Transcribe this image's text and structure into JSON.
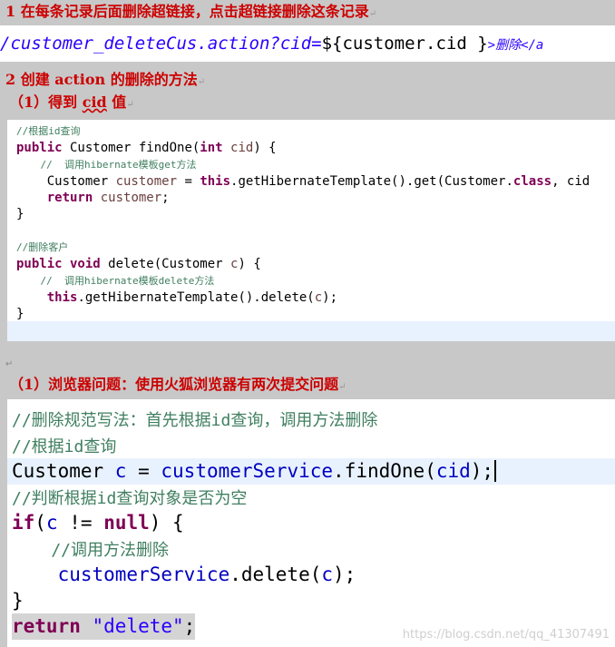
{
  "headings": {
    "h1": "1 在每条记录后面删除超链接，点击超链接删除这条记录",
    "h2": "2 创建 action 的删除的方法",
    "h2_sub_prefix": "（1）得到 ",
    "h2_sub_cid": "cid",
    "h2_sub_suffix": " 值",
    "h3": "（1）浏览器问题：使用火狐浏览器有两次提交问题",
    "return_mark": "↵"
  },
  "url_line": {
    "part1": "/customer_deleteCus.action?cid=",
    "part2": "${customer.cid }",
    "part3": ">删除</a"
  },
  "code1": {
    "c1": "//根据id查询",
    "l1_kw": "public",
    "l1_rest": " Customer findOne(",
    "l1_int": "int",
    "l1_var": " cid",
    "l1_end": ") {",
    "c2": "    //  调用hibernate模板get方法",
    "l2_a": "    Customer ",
    "l2_var": "customer",
    "l2_b": " = ",
    "l2_this": "this",
    "l2_c": ".getHibernateTemplate().get(Customer.",
    "l2_class": "class",
    "l2_d": ", cid",
    "l3_kw": "    return",
    "l3_var": " customer",
    "l3_end": ";",
    "l4": "}",
    "c3": "//删除客户",
    "l5_kw1": "public",
    "l5_kw2": " void",
    "l5_rest": " delete(Customer ",
    "l5_var": "c",
    "l5_end": ") {",
    "c4": "    //  调用hibernate模板delete方法",
    "l6_this": "    this",
    "l6_rest": ".getHibernateTemplate().delete(",
    "l6_var": "c",
    "l6_end": ");",
    "l7": "}"
  },
  "code2": {
    "c1": "//删除规范写法：首先根据id查询，调用方法删除",
    "c2": "//根据id查询",
    "l1_a": "Customer ",
    "l1_var": "c",
    "l1_b": " = ",
    "l1_svc": "customerService",
    "l1_c": ".findOne(",
    "l1_cid": "cid",
    "l1_d": ");",
    "c3": "//判断根据id查询对象是否为空",
    "l2_if": "if",
    "l2_a": "(",
    "l2_var": "c",
    "l2_b": " != ",
    "l2_null": "null",
    "l2_c": ") {",
    "c4": "    //调用方法删除",
    "l3_svc": "    customerService",
    "l3_a": ".delete(",
    "l3_var": "c",
    "l3_b": ");",
    "l4": "}",
    "l5_kw": "return",
    "l5_sp": " ",
    "l5_str": "\"delete\"",
    "l5_end": ";"
  },
  "watermark": "https://blog.csdn.net/qq_41307491",
  "small_mark": "↵"
}
